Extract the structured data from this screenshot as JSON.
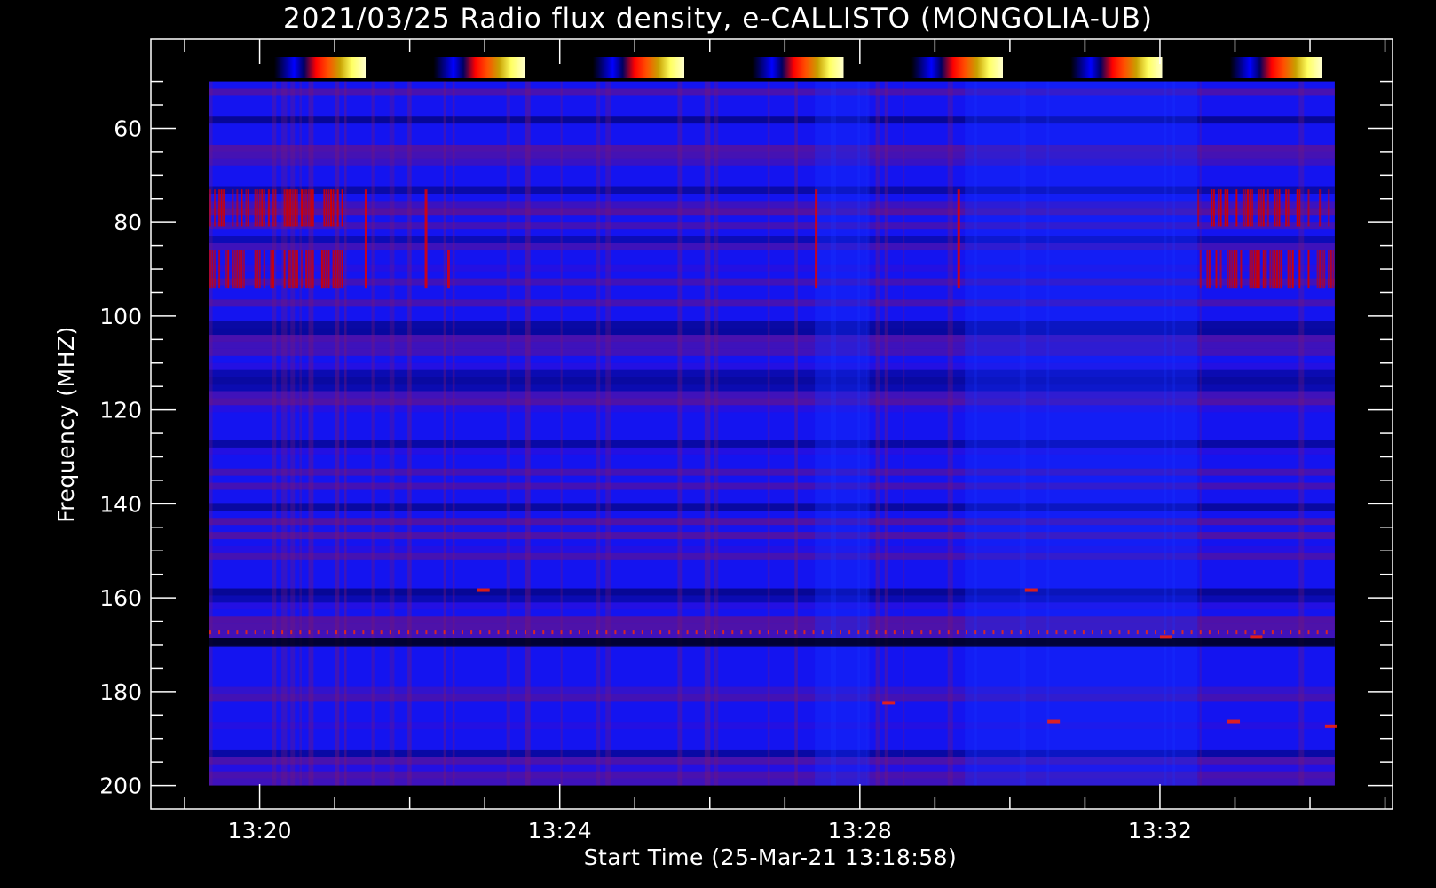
{
  "chart_data": {
    "type": "heatmap",
    "title": "2021/03/25  Radio flux density, e-CALLISTO (MONGOLIA-UB)",
    "xlabel": "Start Time (25-Mar-21 13:18:58)",
    "ylabel": "Frequency (MHZ)",
    "x_ticks": [
      {
        "label": "13:20",
        "minutes": 20
      },
      {
        "label": "13:24",
        "minutes": 24
      },
      {
        "label": "13:28",
        "minutes": 28
      },
      {
        "label": "13:32",
        "minutes": 32
      }
    ],
    "y_ticks": [
      60,
      80,
      100,
      120,
      140,
      160,
      180,
      200
    ],
    "xlim_minutes": [
      18.55,
      35.1
    ],
    "data_x_range_minutes": [
      19.33,
      34.33
    ],
    "ylim": [
      41,
      205
    ],
    "data_y_range": [
      50,
      200
    ],
    "y_inverted": true,
    "colormap": [
      "#000000",
      "#0000ff",
      "#ff0000",
      "#ffd700",
      "#ffffff"
    ],
    "background_color": "#000000",
    "data_base_color": "#1414f0",
    "colorbar_count": 7,
    "red_bands_mhz": [
      {
        "from": 73,
        "to": 81
      },
      {
        "from": 86,
        "to": 94
      }
    ],
    "strong_line_mhz": 167.5,
    "quiet_segments_minutes": [
      {
        "from": 27.4,
        "to": 28.1
      },
      {
        "from": 29.4,
        "to": 32.5
      }
    ],
    "active_segments_minutes": [
      {
        "from": 19.33,
        "to": 20.4
      },
      {
        "from": 20.4,
        "to": 21.1
      },
      {
        "from": 32.5,
        "to": 34.33
      }
    ]
  }
}
